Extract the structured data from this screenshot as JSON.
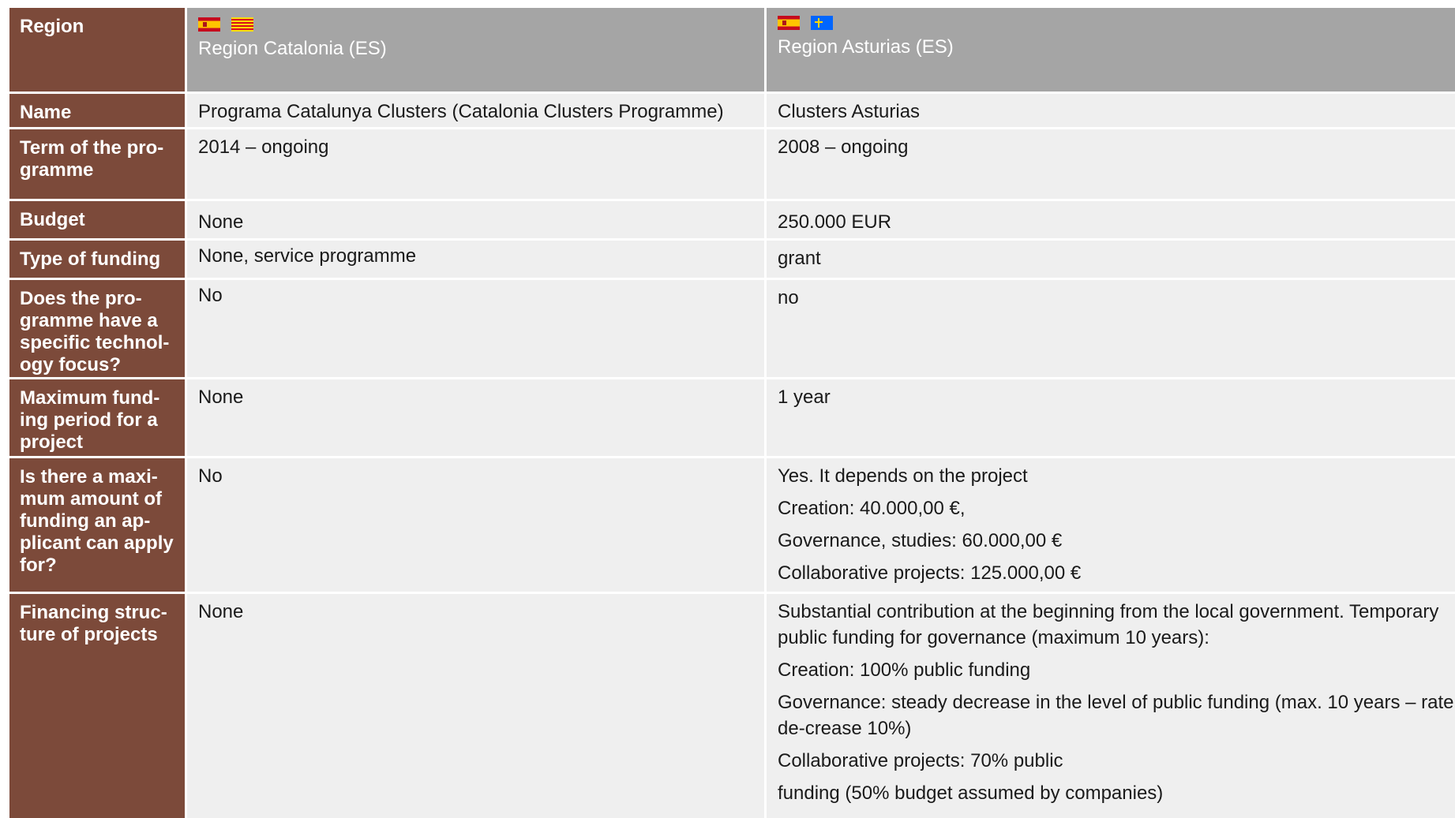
{
  "header": {
    "label": "Region",
    "col1": {
      "title": "Region Catalonia (ES)",
      "flags": [
        "spain-flag-icon",
        "catalonia-flag-icon"
      ]
    },
    "col2": {
      "title": "Region Asturias (ES)",
      "flags": [
        "spain-flag-icon",
        "asturias-flag-icon"
      ]
    }
  },
  "colors": {
    "label_bg": "#7c4a3a",
    "header_bg": "#a5a5a5",
    "cell_bg": "#efefef"
  },
  "rows": [
    {
      "label": "Name",
      "col1": [
        "Programa Catalunya Clusters (Catalonia Clusters Programme)"
      ],
      "col2": [
        "Clusters Asturias"
      ]
    },
    {
      "label": "Term of the pro-gramme",
      "col1": [
        "2014 – ongoing"
      ],
      "col2": [
        "2008 – ongoing"
      ]
    },
    {
      "label": "Budget",
      "col1": [
        "None"
      ],
      "col2": [
        "250.000 EUR"
      ]
    },
    {
      "label": "Type of funding",
      "col1": [
        "None, service programme"
      ],
      "col2": [
        "grant"
      ]
    },
    {
      "label": "Does the pro-gramme have a specific technol-ogy focus?",
      "col1": [
        "No"
      ],
      "col2": [
        "no"
      ]
    },
    {
      "label": "Maximum fund-ing period for a project",
      "col1": [
        "None"
      ],
      "col2": [
        "1 year"
      ]
    },
    {
      "label": "Is there a maxi-mum amount of funding an ap-plicant can apply for?",
      "col1": [
        "No"
      ],
      "col2": [
        "Yes. It depends on the project",
        "Creation: 40.000,00 €,",
        "Governance, studies: 60.000,00 €",
        "Collaborative projects: 125.000,00 €"
      ]
    },
    {
      "label": "Financing struc-ture of projects",
      "col1": [
        "None"
      ],
      "col2": [
        "Substantial contribution at the beginning from the local government. Temporary public funding for governance (maximum 10 years):",
        "Creation: 100% public funding",
        "Governance: steady decrease in the level of public funding (max. 10 years – rate de-crease 10%)",
        "Collaborative projects: 70% public",
        "funding (50% budget assumed by companies)"
      ]
    }
  ]
}
